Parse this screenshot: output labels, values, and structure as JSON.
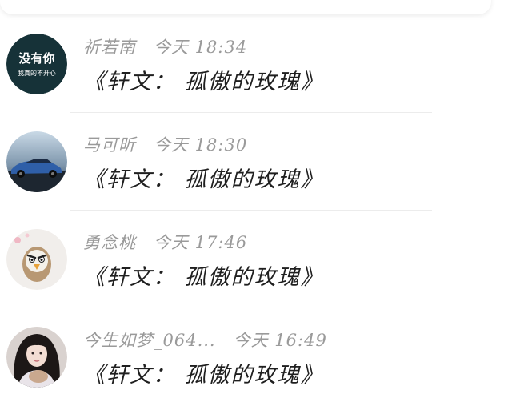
{
  "messages": [
    {
      "sender": "祈若南",
      "time": "今天 18:34",
      "text": "《轩文： 孤傲的玫瑰》",
      "avatar": {
        "line1": "没有你",
        "line2": "我真的不开心",
        "bg": "#163238"
      }
    },
    {
      "sender": "马可昕",
      "time": "今天 18:30",
      "text": "《轩文： 孤傲的玫瑰》",
      "avatar": {
        "description_icon": "sports-car-icon"
      }
    },
    {
      "sender": "勇念桃",
      "time": "今天 17:46",
      "text": "《轩文： 孤傲的玫瑰》",
      "avatar": {
        "description_icon": "angry-bird-icon"
      }
    },
    {
      "sender": "今生如梦_064...",
      "time": "今天 16:49",
      "text": "《轩文： 孤傲的玫瑰》",
      "avatar": {
        "description_icon": "girl-portrait-icon"
      }
    }
  ],
  "colors": {
    "meta": "#9a9a9a",
    "text": "#1f1f1f",
    "divider": "#ececec"
  }
}
